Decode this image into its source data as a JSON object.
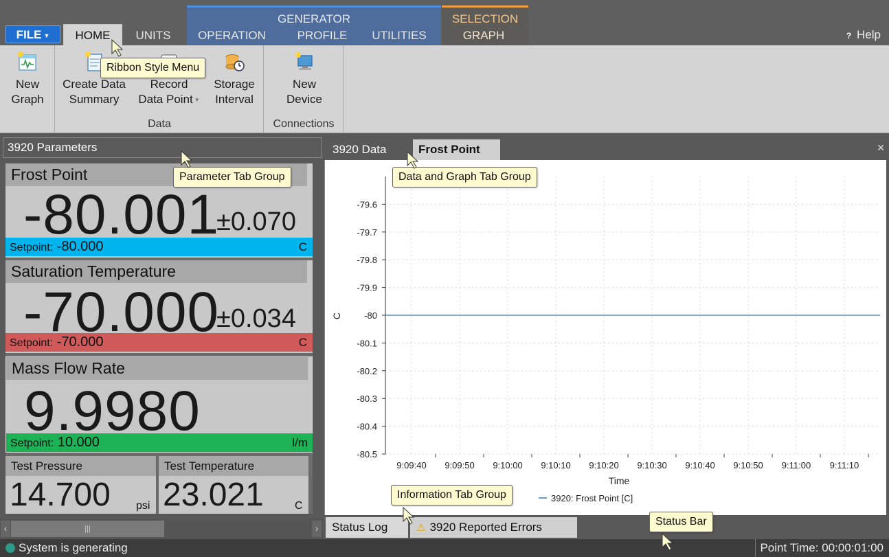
{
  "ribbon": {
    "file_label": "FILE",
    "tabs": {
      "home": "HOME",
      "units": "UNITS",
      "operation": "OPERATION",
      "profile": "PROFILE",
      "utilities": "UTILITIES",
      "graph": "GRAPH"
    },
    "context_groups": {
      "generator": "GENERATOR",
      "selection": "SELECTION"
    },
    "help_label": "Help",
    "buttons": {
      "new_graph": [
        "New",
        "Graph"
      ],
      "create_data_summary": [
        "Create Data",
        "Summary"
      ],
      "record_data_point": [
        "Record",
        "Data Point"
      ],
      "storage_interval": [
        "Storage",
        "Interval"
      ],
      "new_device": [
        "New",
        "Device"
      ]
    },
    "groups": {
      "data": "Data",
      "connections": "Connections"
    }
  },
  "callouts": {
    "ribbon": "Ribbon Style Menu",
    "parameter": "Parameter Tab Group",
    "data_graph": "Data and Graph Tab Group",
    "information": "Information Tab Group",
    "status_bar": "Status Bar"
  },
  "parameters": {
    "header": "3920 Parameters",
    "frost_point": {
      "title": "Frost Point",
      "value": "-80.001",
      "uncertainty": "±0.070",
      "setpoint_label": "Setpoint:",
      "setpoint": "-80.000",
      "unit": "C",
      "color": "#00b5ee"
    },
    "saturation_temperature": {
      "title": "Saturation Temperature",
      "value": "-70.000",
      "uncertainty": "±0.034",
      "setpoint_label": "Setpoint:",
      "setpoint": "-70.000",
      "unit": "C",
      "color": "#d05a5a"
    },
    "mass_flow_rate": {
      "title": "Mass Flow Rate",
      "value": "9.9980",
      "setpoint_label": "Setpoint:",
      "setpoint": "10.000",
      "unit": "l/m",
      "color": "#1eb256"
    },
    "test_pressure": {
      "title": "Test Pressure",
      "value": "14.700",
      "unit": "psi"
    },
    "test_temperature": {
      "title": "Test Temperature",
      "value": "23.021",
      "unit": "C"
    }
  },
  "data_tabs": {
    "data": "3920 Data",
    "frost_point": "Frost Point"
  },
  "info_tabs": {
    "status_log": "Status Log",
    "reported_errors": "3920 Reported Errors"
  },
  "status": {
    "left": "System is generating",
    "right": "Point Time: 00:00:01:00"
  },
  "chart_data": {
    "type": "line",
    "title": "",
    "xlabel": "Time",
    "ylabel": "C",
    "x_ticks": [
      "9:09:40",
      "9:09:50",
      "9:10:00",
      "9:10:10",
      "9:10:20",
      "9:10:30",
      "9:10:40",
      "9:10:50",
      "9:11:00",
      "9:11:10"
    ],
    "y_ticks": [
      "-79.6",
      "-79.7",
      "-79.8",
      "-79.9",
      "-80",
      "-80.1",
      "-80.2",
      "-80.3",
      "-80.4",
      "-80.5"
    ],
    "ylim": [
      -80.5,
      -79.5
    ],
    "grid": true,
    "legend_position": "bottom",
    "series": [
      {
        "name": "3920: Frost Point [C]",
        "color": "#3a74b8",
        "x": [
          "9:09:40",
          "9:11:10"
        ],
        "values": [
          -80.0,
          -80.0
        ]
      }
    ]
  }
}
